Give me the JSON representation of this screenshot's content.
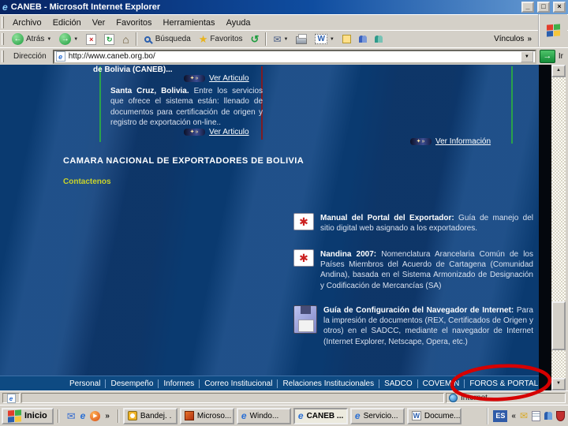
{
  "window": {
    "title": "CANEB - Microsoft Internet Explorer",
    "minimize": "_",
    "restore": "□",
    "close": "×"
  },
  "menu": {
    "items": [
      "Archivo",
      "Edición",
      "Ver",
      "Favoritos",
      "Herramientas",
      "Ayuda"
    ]
  },
  "toolbar": {
    "back": "Atrás",
    "search": "Búsqueda",
    "favorites": "Favoritos",
    "links": "Vínculos"
  },
  "address": {
    "label": "Dirección",
    "url": "http://www.caneb.org.bo/",
    "go": "Ir"
  },
  "icons": {
    "back_arrow": "←",
    "forward_arrow": "→",
    "stop": "×",
    "refresh": "↻",
    "home": "⌂",
    "star": "★",
    "history": "↺",
    "mail": "✉",
    "edit_w": "W",
    "dropdown": "▼",
    "up": "▲",
    "down": "▼",
    "play": "▶",
    "pdf_swirl": "✱",
    "sparkle": "✦»",
    "chev_right": "»",
    "chev_left": "«",
    "go_arrow": "→",
    "ie_e": "e",
    "word_w": "W"
  },
  "page": {
    "intro_fragment": "de Bolivia (CANEB)...",
    "article_link1": "Ver Articulo",
    "news_lead": "Santa Cruz, Bolivia.",
    "news_body": "Entre los servicios que ofrece el sistema están: llenado de documentos para certificación de origen y registro de exportación on-line..",
    "article_link2": "Ver Articulo",
    "info_link": "Ver Información",
    "heading": "CAMARA NACIONAL DE EXPORTADORES DE BOLIVIA",
    "contact": "Contactenos",
    "downloads": [
      {
        "lead": "Manual del Portal del Exportador:",
        "text": "Guía de manejo del sitio digital web asignado a los exportadores."
      },
      {
        "lead": "Nandina 2007:",
        "text": "Nomenclatura Arancelaria Común de los Países Miembros del Acuerdo de Cartagena (Comunidad Andina), basada en el Sistema Armonizado de Designación y Codificación de Mercancías (SA)"
      },
      {
        "lead": "Guía de Configuración del Navegador de Internet:",
        "text": "Para la impresión de documentos (REX, Certificados de Origen y otros) en el SADCC, mediante el navegador de Internet (Internet Explorer, Netscape, Opera, etc.)"
      }
    ],
    "nav": [
      "Personal",
      "Desempeño",
      "Informes",
      "Correo Institucional",
      "Relaciones Institucionales",
      "SADCO",
      "COVEMIN",
      "FOROS & PORTALES"
    ],
    "annotation": {
      "shape": "ellipse",
      "color": "#d60000",
      "target": "FOROS & PORTALES"
    }
  },
  "status": {
    "zone": "Internet"
  },
  "taskbar": {
    "start": "Inicio",
    "buttons": [
      {
        "label": "Bandej. ."
      },
      {
        "label": "Microso..."
      },
      {
        "label": "Windo..."
      },
      {
        "label": "CANEB ..."
      },
      {
        "label": "Servicio..."
      },
      {
        "label": "Docume..."
      }
    ],
    "tray_language": "ES"
  }
}
